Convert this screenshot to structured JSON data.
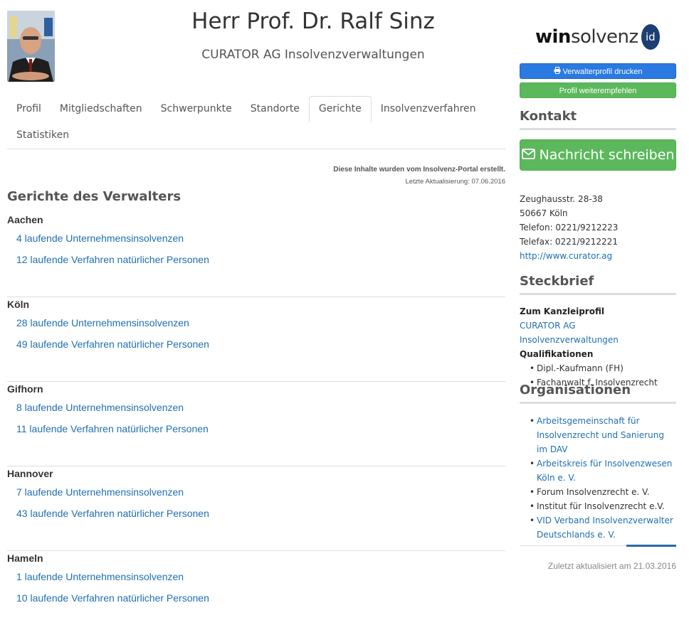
{
  "profile": {
    "name": "Herr Prof. Dr. Ralf Sinz",
    "company": "CURATOR AG Insolvenzverwaltungen"
  },
  "tabs": [
    {
      "label": "Profil",
      "active": false
    },
    {
      "label": "Mitgliedschaften",
      "active": false
    },
    {
      "label": "Schwerpunkte",
      "active": false
    },
    {
      "label": "Standorte",
      "active": false
    },
    {
      "label": "Gerichte",
      "active": true
    },
    {
      "label": "Insolvenzverfahren",
      "active": false
    },
    {
      "label": "Statistiken",
      "active": false
    }
  ],
  "notice": {
    "text": "Diese Inhalte wurden vom Insolvenz-Portal erstellt.",
    "updated": "Letzte Aktualisierung: 07.06.2016"
  },
  "courts_section": {
    "title": "Gerichte des Verwalters",
    "courts": [
      {
        "name": "Aachen",
        "company_link": "4 laufende Unternehmensinsolvenzen",
        "person_link": "12 laufende Verfahren natürlicher Personen"
      },
      {
        "name": "Köln",
        "company_link": "28 laufende Unternehmensinsolvenzen",
        "person_link": "49 laufende Verfahren natürlicher Personen"
      },
      {
        "name": "Gifhorn",
        "company_link": "8 laufende Unternehmensinsolvenzen",
        "person_link": "11 laufende Verfahren natürlicher Personen"
      },
      {
        "name": "Hannover",
        "company_link": "7 laufende Unternehmensinsolvenzen",
        "person_link": "43 laufende Verfahren natürlicher Personen"
      },
      {
        "name": "Hameln",
        "company_link": "1 laufende Unternehmensinsolvenzen",
        "person_link": "10 laufende Verfahren natürlicher Personen"
      }
    ]
  },
  "sidebar": {
    "logo": {
      "win": "win",
      "solvenz": "solvenz",
      "id": "id"
    },
    "print_button": "Verwalterprofil drucken",
    "recommend_button": "Profil weiterempfehlen",
    "contact_heading": "Kontakt",
    "message_button": "Nachricht schreiben",
    "address": {
      "street": "Zeughausstr. 28-38",
      "city": "50667 Köln",
      "phone": "Telefon: 0221/9212223",
      "fax": "Telefax: 0221/9212221",
      "website": "http://www.curator.ag"
    },
    "steckbrief_heading": "Steckbrief",
    "steckbrief": {
      "kanzlei_label": "Zum Kanzleiprofil",
      "kanzlei_link": "CURATOR AG Insolvenzverwaltungen",
      "qual_label": "Qualifikationen",
      "qualifications": [
        "Dipl.-Kaufmann (FH)",
        "Fachanwalt f. Insolvenzrecht"
      ]
    },
    "organisations_heading": "Organisationen",
    "organisations": [
      {
        "label": "Arbeitsgemeinschaft für Insolvenzrecht und Sanierung im DAV",
        "link": true
      },
      {
        "label": "Arbeitskreis für Insolvenzwesen Köln e. V.",
        "link": true
      },
      {
        "label": "Forum Insolvenzrecht e. V.",
        "link": false
      },
      {
        "label": "Institut für Insolvenzrecht e.V.",
        "link": false
      },
      {
        "label": "VID Verband Insolvenzverwalter Deutschlands e. V.",
        "link": true
      }
    ],
    "last_updated": "Zuletzt aktualisiert am 21.03.2016"
  },
  "colors": {
    "link": "#1f6fb2",
    "print_button": "#2a7ae2",
    "green_button": "#5cb85c",
    "logo_badge": "#1c3f73"
  }
}
